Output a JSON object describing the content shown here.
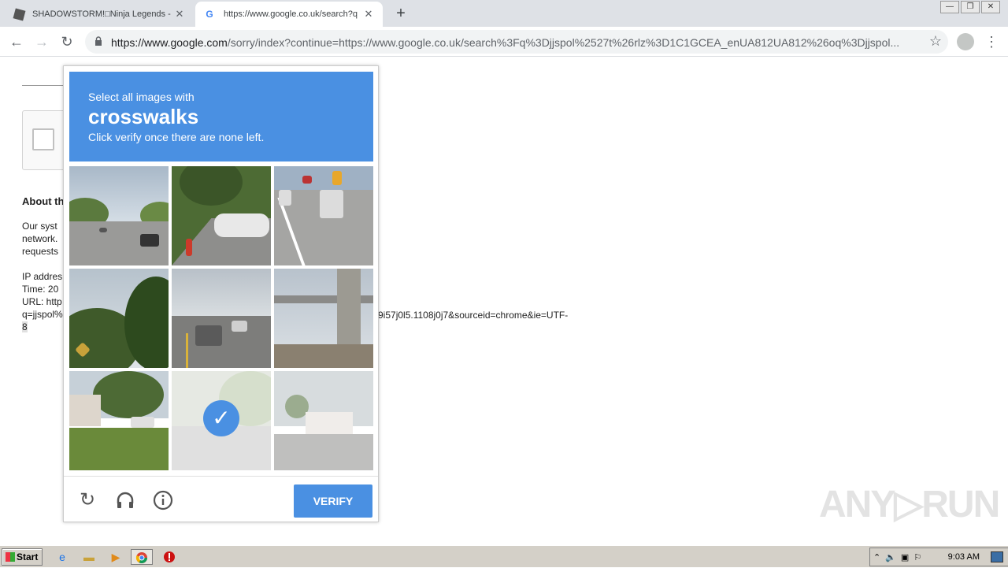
{
  "browser": {
    "tabs": [
      {
        "title": "SHADOWSTORM!□Ninja Legends - R",
        "favicon": "roblox-icon"
      },
      {
        "title": "https://www.google.co.uk/search?q",
        "favicon": "google-icon"
      }
    ],
    "new_tab": "+",
    "window_controls": [
      "—",
      "❐",
      "✕"
    ],
    "url_host": "https://www.google.com",
    "url_rest": "/sorry/index?continue=https://www.google.co.uk/search%3Fq%3Djjspol%2527t%26rlz%3D1C1GCEA_enUA812UA812%26oq%3Djjspol..."
  },
  "page": {
    "about_heading": "About th",
    "lines": [
      "Our syst",
      "network.",
      "requests",
      "",
      "IP addres",
      "Time: 20",
      "URL: http",
      "q=jjspol%",
      "8"
    ],
    "url_tail": "9i57j0l5.1108j0j7&sourceid=chrome&ie=UTF-"
  },
  "captcha": {
    "instruction": "Select all images with",
    "target": "crosswalks",
    "hint": "Click verify once there are none left.",
    "verify_label": "VERIFY",
    "tiles": [
      {
        "scene": "highway",
        "selected": false
      },
      {
        "scene": "parking-car",
        "selected": false
      },
      {
        "scene": "highway-trucks",
        "selected": false
      },
      {
        "scene": "trees",
        "selected": false
      },
      {
        "scene": "intersection",
        "selected": false
      },
      {
        "scene": "overpass",
        "selected": false
      },
      {
        "scene": "house-lawn",
        "selected": false
      },
      {
        "scene": "road-selected",
        "selected": true
      },
      {
        "scene": "house-palm",
        "selected": false
      }
    ]
  },
  "watermark": "ANY▷RUN",
  "taskbar": {
    "start_label": "Start",
    "clock": "9:03 AM"
  }
}
